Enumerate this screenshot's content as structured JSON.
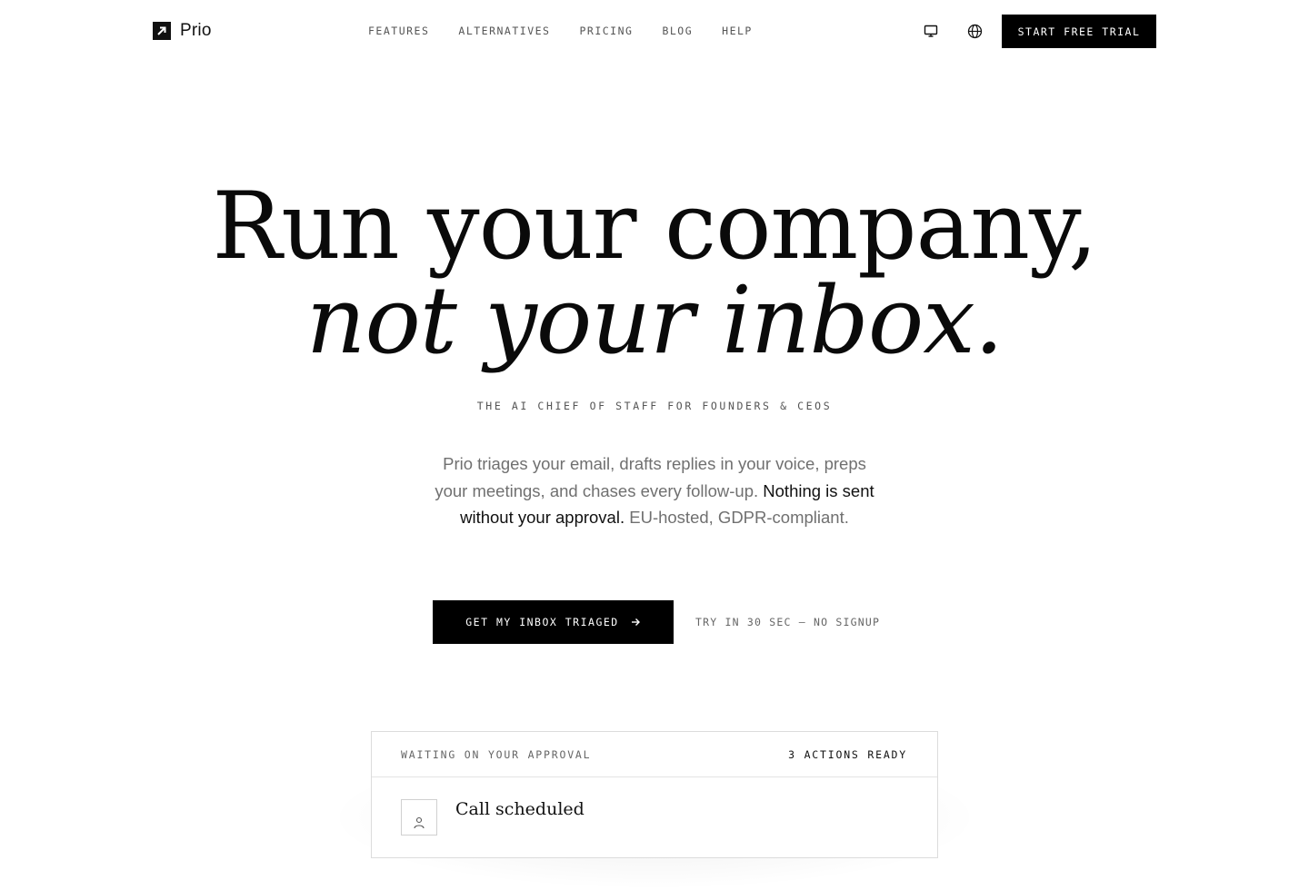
{
  "nav": {
    "brand": "Prio",
    "links": [
      "FEATURES",
      "ALTERNATIVES",
      "PRICING",
      "BLOG",
      "HELP"
    ],
    "icons": [
      "monitor-icon",
      "globe-icon"
    ],
    "cta_label": "START FREE TRIAL"
  },
  "hero": {
    "headline_line1": "Run your company,",
    "headline_line2": "not your inbox.",
    "eyebrow": "THE AI CHIEF OF STAFF FOR FOUNDERS & CEOS",
    "lede_part1": "Prio triages your email, drafts replies in your voice, preps your meetings, and chases every follow-up. ",
    "lede_emphasis": "Nothing is sent without your approval.",
    "lede_part2": " EU-hosted, GDPR-compliant.",
    "cta_label": "GET MY INBOX TRIAGED",
    "cta_note": "TRY IN 30 SEC — NO SIGNUP"
  },
  "approval_card": {
    "title": "WAITING ON YOUR APPROVAL",
    "count_label": "3 ACTIONS READY",
    "items": [
      {
        "title": "Call scheduled",
        "icon": "person-icon"
      }
    ]
  },
  "colors": {
    "primary": "#000000",
    "text": "#111111",
    "muted": "#707070",
    "border": "#dcdcdc",
    "background": "#ffffff"
  }
}
